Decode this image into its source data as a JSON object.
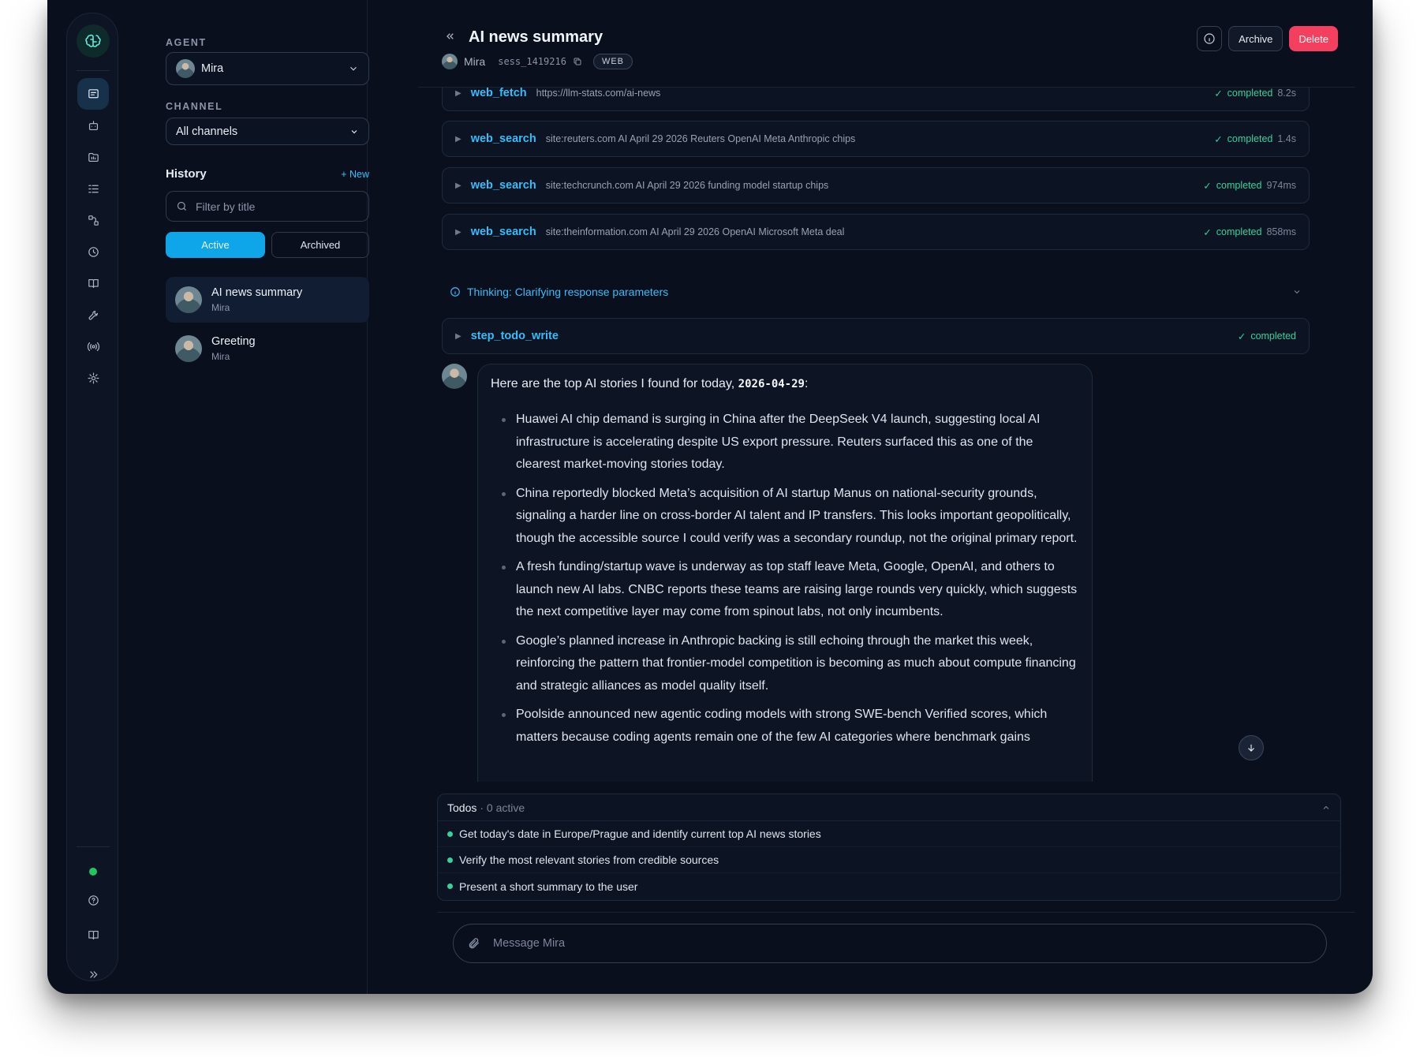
{
  "sidebar": {
    "agent_label": "AGENT",
    "agent_value": "Mira",
    "channel_label": "CHANNEL",
    "channel_value": "All channels",
    "history_title": "History",
    "new_label": "+ New",
    "filter_placeholder": "Filter by title",
    "tabs": {
      "active": "Active",
      "archived": "Archived"
    },
    "sessions": [
      {
        "title": "AI news summary",
        "agent": "Mira"
      },
      {
        "title": "Greeting",
        "agent": "Mira"
      }
    ]
  },
  "header": {
    "title": "AI news summary",
    "agent": "Mira",
    "session_id": "sess_1419216",
    "channel_badge": "WEB",
    "archive_label": "Archive",
    "delete_label": "Delete"
  },
  "tools": [
    {
      "name": "web_fetch",
      "arg": "https://llm-stats.com/ai-news",
      "status": "completed",
      "duration": "8.2s"
    },
    {
      "name": "web_search",
      "arg": "site:reuters.com AI April 29 2026 Reuters OpenAI Meta Anthropic chips",
      "status": "completed",
      "duration": "1.4s"
    },
    {
      "name": "web_search",
      "arg": "site:techcrunch.com AI April 29 2026 funding model startup chips",
      "status": "completed",
      "duration": "974ms"
    },
    {
      "name": "web_search",
      "arg": "site:theinformation.com AI April 29 2026 OpenAI Microsoft Meta deal",
      "status": "completed",
      "duration": "858ms"
    }
  ],
  "thinking": "Thinking: Clarifying response parameters",
  "todo_tool": {
    "name": "step_todo_write",
    "status": "completed"
  },
  "message": {
    "intro": "Here are the top AI stories I found for today,",
    "date": "2026-04-29",
    "intro_end": ":",
    "bullets": [
      "Huawei AI chip demand is surging in China after the DeepSeek V4 launch, suggesting local AI infrastructure is accelerating despite US export pressure. Reuters surfaced this as one of the clearest market-moving stories today.",
      "China reportedly blocked Meta’s acquisition of AI startup Manus on national-security grounds, signaling a harder line on cross-border AI talent and IP transfers. This looks important geopolitically, though the accessible source I could verify was a secondary roundup, not the original primary report.",
      "A fresh funding/startup wave is underway as top staff leave Meta, Google, OpenAI, and others to launch new AI labs. CNBC reports these teams are raising large rounds very quickly, which suggests the next competitive layer may come from spinout labs, not only incumbents.",
      "Google’s planned increase in Anthropic backing is still echoing through the market this week, reinforcing the pattern that frontier-model competition is becoming as much about compute financing and strategic alliances as model quality itself.",
      "Poolside announced new agentic coding models with strong SWE-bench Verified scores, which matters because coding agents remain one of the few AI categories where benchmark gains"
    ]
  },
  "todos": {
    "title": "Todos",
    "count": "· 0 active",
    "items": [
      "Get today's date in Europe/Prague and identify current top AI news stories",
      "Verify the most relevant stories from credible sources",
      "Present a short summary to the user"
    ]
  },
  "composer": {
    "placeholder": "Message Mira"
  },
  "colors": {
    "accent": "#0ea5e9",
    "tool_name": "#38bdf8",
    "success": "#34d399",
    "danger": "#f43f5e",
    "background": "#0a0f1e"
  }
}
